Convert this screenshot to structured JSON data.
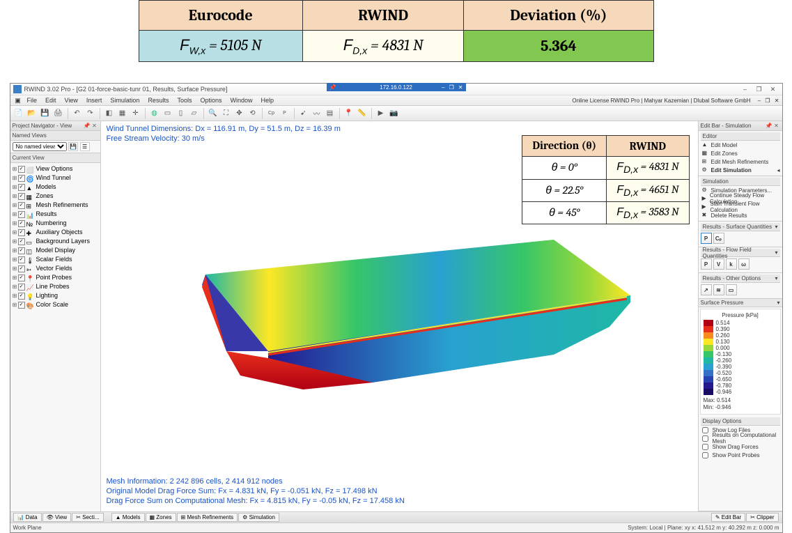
{
  "top_table": {
    "headers": [
      "Eurocode",
      "RWIND",
      "Deviation (%)"
    ],
    "eurocode": "F_{W,x} = 5105 N",
    "rwind": "F_{D,x} = 4831 N",
    "deviation": "5.364"
  },
  "app": {
    "title": "RWIND 3.02 Pro - [G2 01-force-basic-tunr 01, Results, Surface Pressure]",
    "remote_ip": "172.16.0.122",
    "license": "Online License RWIND Pro | Mahyar Kazemian | Dlubal Software GmbH",
    "menu": [
      "File",
      "Edit",
      "View",
      "Insert",
      "Simulation",
      "Results",
      "Tools",
      "Options",
      "Window",
      "Help"
    ]
  },
  "left": {
    "nav_title": "Project Navigator - View",
    "named_title": "Named Views",
    "named_placeholder": "No named views",
    "current_title": "Current View",
    "tree": [
      {
        "lbl": "View Options"
      },
      {
        "lbl": "Wind Tunnel"
      },
      {
        "lbl": "Models"
      },
      {
        "lbl": "Zones"
      },
      {
        "lbl": "Mesh Refinements"
      },
      {
        "lbl": "Results"
      },
      {
        "lbl": "Numbering"
      },
      {
        "lbl": "Auxiliary Objects"
      },
      {
        "lbl": "Background Layers"
      },
      {
        "lbl": "Model Display"
      },
      {
        "lbl": "Scalar Fields"
      },
      {
        "lbl": "Vector Fields"
      },
      {
        "lbl": "Point Probes"
      },
      {
        "lbl": "Line Probes"
      },
      {
        "lbl": "Lighting"
      },
      {
        "lbl": "Color Scale"
      }
    ]
  },
  "viewport": {
    "top_line1": "Wind Tunnel Dimensions: Dx = 116.91 m, Dy = 51.5 m, Dz = 16.39 m",
    "top_line2": "Free Stream Velocity: 30 m/s",
    "bot_line1": "Mesh Information: 2 242 896 cells, 2 414 912 nodes",
    "bot_line2": "Original Model Drag Force Sum: Fx = 4.831 kN, Fy = -0.051 kN, Fz = 17.498 kN",
    "bot_line3": "Drag Force Sum on Computational Mesh: Fx = 4.815 kN, Fy = -0.05 kN, Fz = 17.458 kN"
  },
  "dir_table": {
    "head_dir": "Direction (θ)",
    "head_val": "RWIND",
    "rows": [
      {
        "dir": "θ = 0°",
        "val": "F_{D,x} = 4831 N"
      },
      {
        "dir": "θ = 22.5°",
        "val": "F_{D,x} = 4651 N"
      },
      {
        "dir": "θ = 45°",
        "val": "F_{D,x} = 3583 N"
      }
    ]
  },
  "right": {
    "editbar_title": "Edit Bar - Simulation",
    "editor_title": "Editor",
    "editor_items": [
      "Edit Model",
      "Edit Zones",
      "Edit Mesh Refinements",
      "Edit Simulation"
    ],
    "sim_title": "Simulation",
    "sim_items": [
      "Simulation Parameters...",
      "Continue Steady Flow Calculation",
      "Start Transient Flow Calculation",
      "Delete Results"
    ],
    "res_surf": "Results - Surface Quantities",
    "res_flow": "Results - Flow Field Quantities",
    "res_other": "Results - Other Options",
    "pressure_title": "Surface Pressure",
    "pressure_unit": "Pressure [kPa]",
    "colorbar": [
      {
        "c": "#b00014",
        "v": "0.514"
      },
      {
        "c": "#e62e1b",
        "v": "0.390"
      },
      {
        "c": "#f98b1e",
        "v": "0.260"
      },
      {
        "c": "#fde725",
        "v": "0.130"
      },
      {
        "c": "#98d83b",
        "v": "0.000"
      },
      {
        "c": "#37c667",
        "v": "-0.130"
      },
      {
        "c": "#1eb8a5",
        "v": "-0.260"
      },
      {
        "c": "#29a0d0",
        "v": "-0.390"
      },
      {
        "c": "#3371c7",
        "v": "-0.520"
      },
      {
        "c": "#2842b1",
        "v": "-0.650"
      },
      {
        "c": "#24188f",
        "v": "-0.780"
      },
      {
        "c": "#190a63",
        "v": "-0.946"
      }
    ],
    "max": "Max:   0.514",
    "min": "Min:  -0.946",
    "disp_title": "Display Options",
    "disp_opts": [
      "Show Log Files",
      "Results on Computational Mesh",
      "Show Drag Forces",
      "Show Point Probes"
    ]
  },
  "bottom": {
    "left_tabs": [
      "Data",
      "View",
      "Secti..."
    ],
    "mid_tabs": [
      "Models",
      "Zones",
      "Mesh Refinements",
      "Simulation"
    ],
    "right_tabs": [
      "Edit Bar",
      "Clipper"
    ],
    "status_left": "Work Plane",
    "status_right": "System: Local | Plane: xy   x: 41.512 m   y: 40.292 m   z: 0.000 m"
  }
}
